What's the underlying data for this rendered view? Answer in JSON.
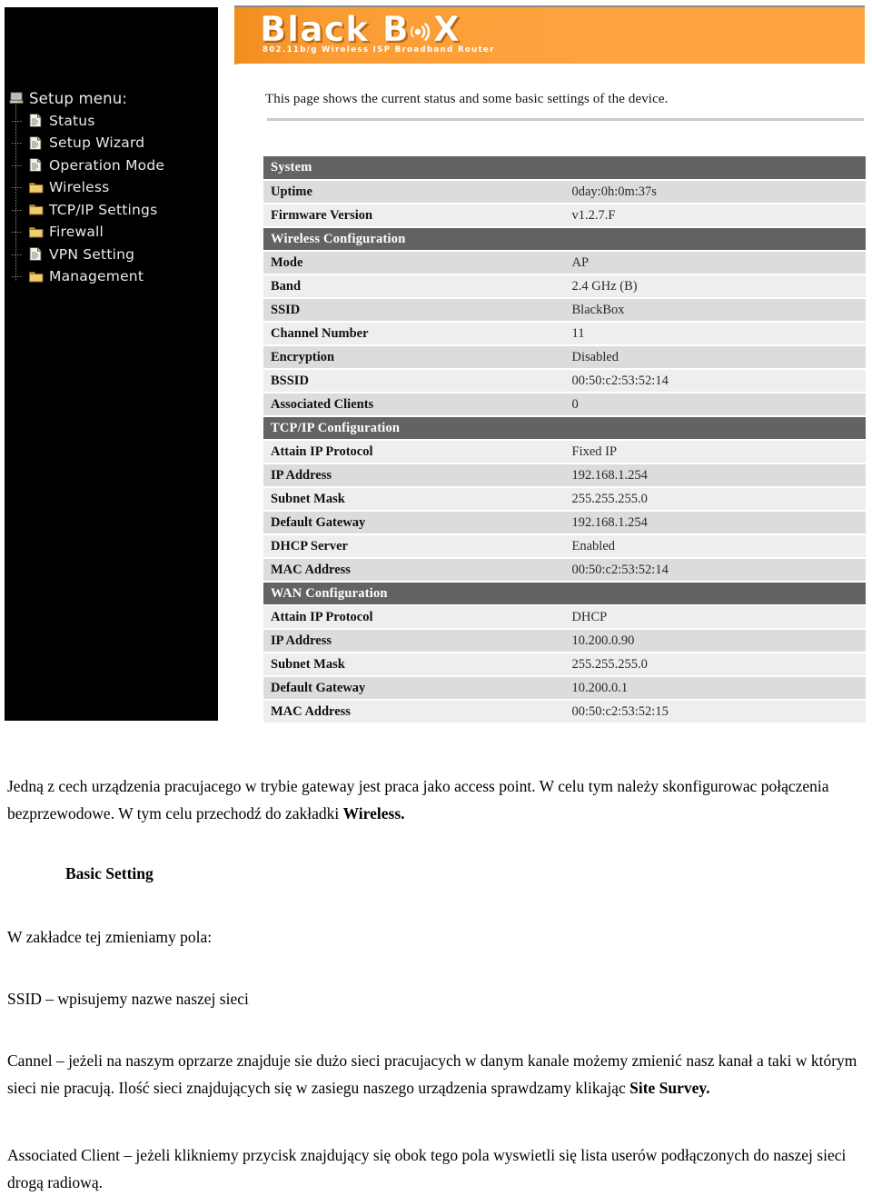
{
  "brand": {
    "name": "Black Box",
    "name_part1": "Black B",
    "name_part2": "X",
    "tagline": "802.11b/g Wireless ISP Broadband Router",
    "wifi_icon": "wifi-signal-icon",
    "banner_color": "#fda33f"
  },
  "sidebar": {
    "root": {
      "label": "Setup menu:",
      "icon": "computer-root-icon"
    },
    "items": [
      {
        "label": "Status",
        "icon": "document-icon"
      },
      {
        "label": "Setup Wizard",
        "icon": "document-icon"
      },
      {
        "label": "Operation Mode",
        "icon": "document-icon"
      },
      {
        "label": "Wireless",
        "icon": "folder-icon"
      },
      {
        "label": "TCP/IP Settings",
        "icon": "folder-icon"
      },
      {
        "label": "Firewall",
        "icon": "folder-icon"
      },
      {
        "label": "VPN Setting",
        "icon": "document-icon"
      },
      {
        "label": "Management",
        "icon": "folder-icon"
      }
    ]
  },
  "page": {
    "intro": "This page shows the current status and some basic settings of the device."
  },
  "status_table": {
    "sections": [
      {
        "title": "System",
        "rows": [
          {
            "key": "Uptime",
            "value": "0day:0h:0m:37s"
          },
          {
            "key": "Firmware Version",
            "value": "v1.2.7.F"
          }
        ]
      },
      {
        "title": "Wireless Configuration",
        "rows": [
          {
            "key": "Mode",
            "value": "AP"
          },
          {
            "key": "Band",
            "value": "2.4 GHz (B)"
          },
          {
            "key": "SSID",
            "value": "BlackBox"
          },
          {
            "key": "Channel Number",
            "value": "11"
          },
          {
            "key": "Encryption",
            "value": "Disabled"
          },
          {
            "key": "BSSID",
            "value": "00:50:c2:53:52:14"
          },
          {
            "key": "Associated Clients",
            "value": "0"
          }
        ]
      },
      {
        "title": "TCP/IP Configuration",
        "rows": [
          {
            "key": "Attain IP Protocol",
            "value": "Fixed IP"
          },
          {
            "key": "IP Address",
            "value": "192.168.1.254"
          },
          {
            "key": "Subnet Mask",
            "value": "255.255.255.0"
          },
          {
            "key": "Default Gateway",
            "value": "192.168.1.254"
          },
          {
            "key": "DHCP Server",
            "value": "Enabled"
          },
          {
            "key": "MAC Address",
            "value": "00:50:c2:53:52:14"
          }
        ]
      },
      {
        "title": "WAN Configuration",
        "rows": [
          {
            "key": "Attain IP Protocol",
            "value": "DHCP"
          },
          {
            "key": "IP Address",
            "value": "10.200.0.90"
          },
          {
            "key": "Subnet Mask",
            "value": "255.255.255.0"
          },
          {
            "key": "Default Gateway",
            "value": "10.200.0.1"
          },
          {
            "key": "MAC Address",
            "value": "00:50:c2:53:52:15"
          }
        ]
      }
    ]
  },
  "document": {
    "intro_part1": "Jedną z cech urządzenia pracujacego w trybie gateway jest praca jako access point. W celu tym należy skonfigurowac połączenia bezprzewodowe. W tym celu przechodź do zakładki ",
    "intro_bold": "Wireless.",
    "heading_basic": "Basic Setting",
    "fields_line": "W zakładce tej zmieniamy pola:",
    "ssid_line": "SSID – wpisujemy nazwe naszej sieci",
    "channel_part1": "Cannel – jeżeli na naszym oprzarze znajduje sie dużo sieci pracujacych w danym kanale możemy zmienić nasz kanał a taki w którym sieci nie pracują. Ilość sieci znajdujących się w zasiegu naszego urządzenia sprawdzamy klikając ",
    "channel_bold": "Site Survey.",
    "assoc_line": "Associated Client – jeżeli klikniemy przycisk znajdujący się obok tego pola wyswietli się lista userów podłączonych do naszej sieci drogą radiową."
  }
}
